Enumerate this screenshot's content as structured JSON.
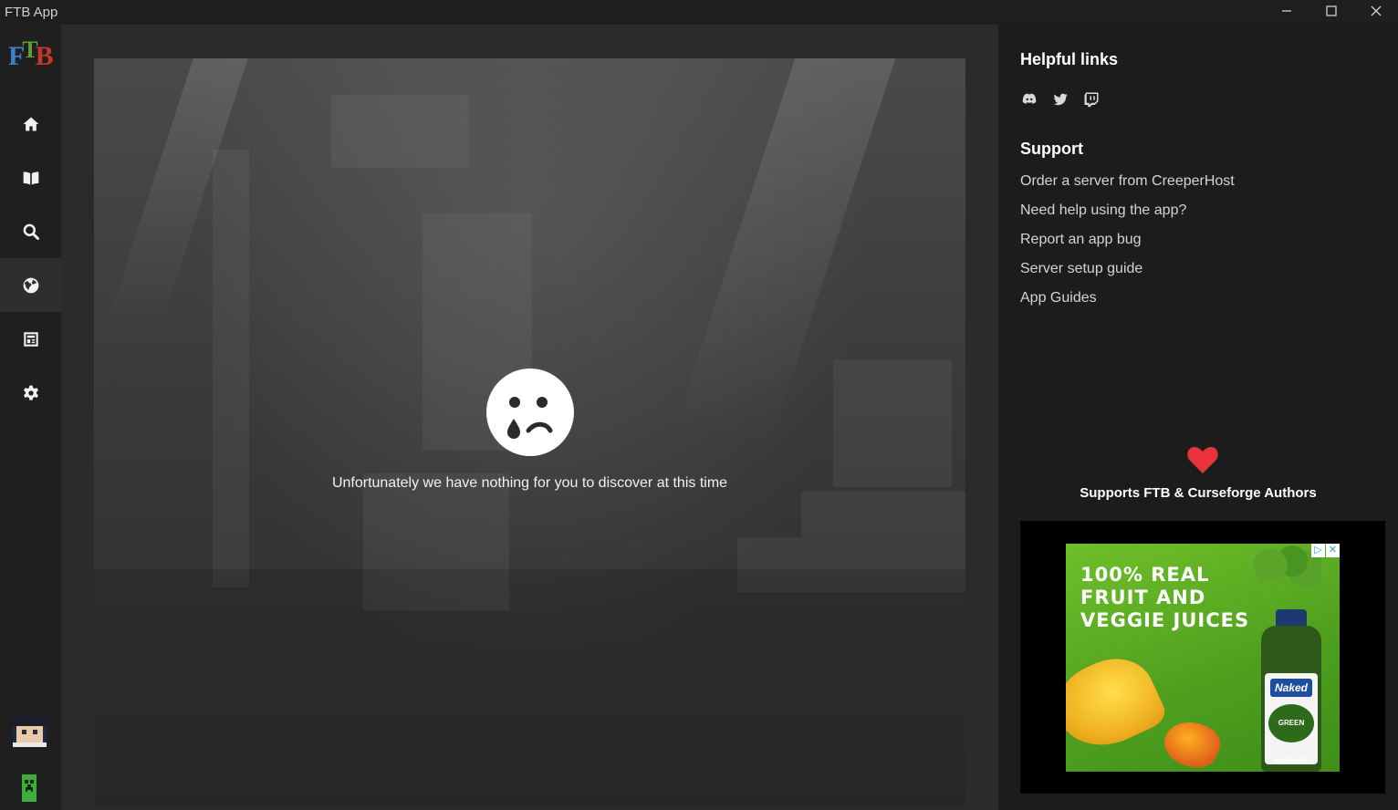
{
  "window": {
    "title": "FTB App",
    "controls": [
      "minimize",
      "maximize",
      "close"
    ]
  },
  "sidebar": {
    "logo": {
      "letters": [
        "F",
        "T",
        "B"
      ]
    },
    "items": [
      {
        "id": "home",
        "icon": "home-icon",
        "active": false
      },
      {
        "id": "library",
        "icon": "book-open-icon",
        "active": false
      },
      {
        "id": "search",
        "icon": "search-icon",
        "active": false
      },
      {
        "id": "discover",
        "icon": "globe-icon",
        "active": true
      },
      {
        "id": "news",
        "icon": "newspaper-icon",
        "active": false
      },
      {
        "id": "settings",
        "icon": "gear-icon",
        "active": false
      }
    ],
    "user_avatar": "avatar",
    "bottom_icon": "creeper-icon"
  },
  "main": {
    "empty_message": "Unfortunately we have nothing for you to discover at this time",
    "empty_icon": "sad-tear-icon"
  },
  "panel": {
    "helpful_links_title": "Helpful links",
    "social": [
      {
        "id": "discord",
        "icon": "discord-icon"
      },
      {
        "id": "twitter",
        "icon": "twitter-icon"
      },
      {
        "id": "twitch",
        "icon": "twitch-icon"
      }
    ],
    "support_title": "Support",
    "support_links": [
      "Order a server from CreeperHost",
      "Need help using the app?",
      "Report an app bug",
      "Server setup guide",
      "App Guides"
    ],
    "supports_text": "Supports FTB & Curseforge Authors",
    "heart_color": "#e8323c",
    "ad": {
      "headline_lines": [
        "100% REAL",
        "FRUIT AND",
        "VEGGIE JUICES"
      ],
      "brand": "Naked",
      "product": "GREEN MACHINE",
      "adchoices": [
        "▷",
        "✕"
      ]
    }
  }
}
